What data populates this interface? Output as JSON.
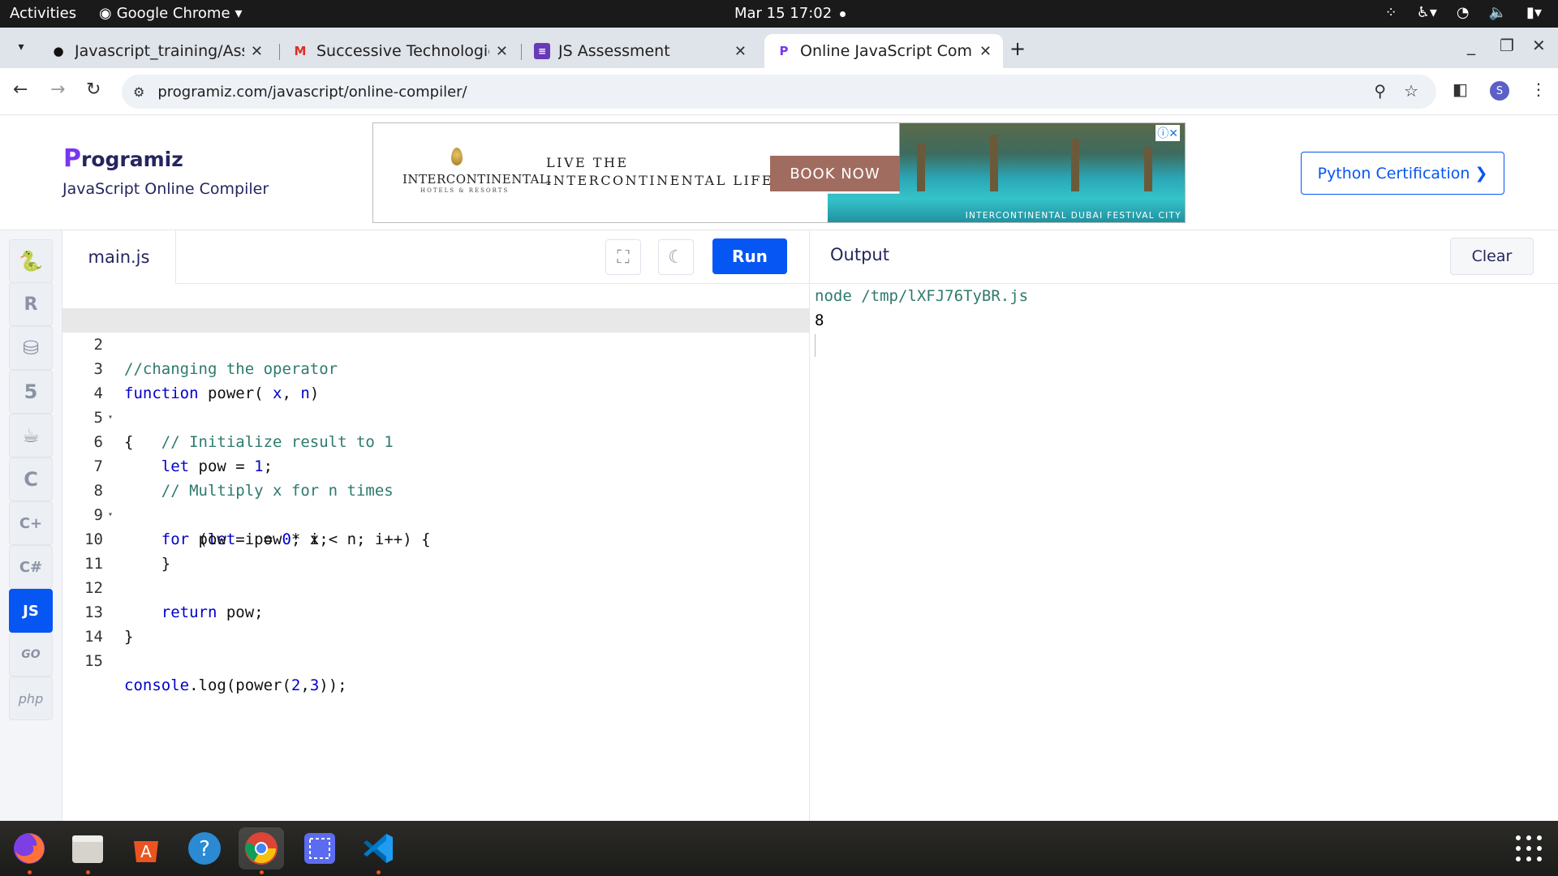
{
  "system_bar": {
    "activities": "Activities",
    "app_name": "Google Chrome",
    "clock": "Mar 15  17:02"
  },
  "browser": {
    "tabs": [
      {
        "label": "Javascript_training/Assi",
        "icon": "github-icon"
      },
      {
        "label": "Successive Technologies",
        "icon": "gmail-icon"
      },
      {
        "label": "JS Assessment",
        "icon": "forms-icon"
      },
      {
        "label": "Online JavaScript Compi",
        "icon": "programiz-icon",
        "active": true
      }
    ],
    "url": "programiz.com/javascript/online-compiler/",
    "profile_initial": "S"
  },
  "header": {
    "brand": "rogramiz",
    "brand_initial": "P",
    "subtitle": "JavaScript Online Compiler",
    "cert_button": "Python Certification",
    "ad": {
      "brand_name": "INTERCONTINENTAL.",
      "brand_tag": "HOTELS & RESORTS",
      "slogan_line1": "LIVE THE",
      "slogan_line2": "INTERCONTINENTAL LIFE",
      "cta": "BOOK NOW",
      "caption": "INTERCONTINENTAL DUBAI FESTIVAL CITY"
    }
  },
  "rail": [
    {
      "name": "python-icon",
      "glyph": "Py"
    },
    {
      "name": "r-icon",
      "glyph": "R"
    },
    {
      "name": "sql-icon",
      "glyph": "DB"
    },
    {
      "name": "html-icon",
      "glyph": "5"
    },
    {
      "name": "java-icon",
      "glyph": "J"
    },
    {
      "name": "c-icon",
      "glyph": "C"
    },
    {
      "name": "cpp-icon",
      "glyph": "C+"
    },
    {
      "name": "csharp-icon",
      "glyph": "C#"
    },
    {
      "name": "javascript-icon",
      "glyph": "JS",
      "active": true
    },
    {
      "name": "go-icon",
      "glyph": "GO"
    },
    {
      "name": "php-icon",
      "glyph": "php"
    }
  ],
  "editor": {
    "file_name": "main.js",
    "run_label": "Run",
    "lines": [
      "",
      "//changing the operator",
      "function power( x, n)",
      "{",
      "    // Initialize result to 1",
      "    let pow = 1;",
      "    // Multiply x for n times",
      "    for (let i = 0; i < n; i++) {",
      "        pow = pow * x;",
      "    }",
      "",
      "    return pow;",
      "}",
      "",
      "console.log(power(2,3));"
    ]
  },
  "output": {
    "title": "Output",
    "clear_label": "Clear",
    "lines": [
      "node /tmp/lXFJ76TyBR.js",
      "8"
    ]
  }
}
